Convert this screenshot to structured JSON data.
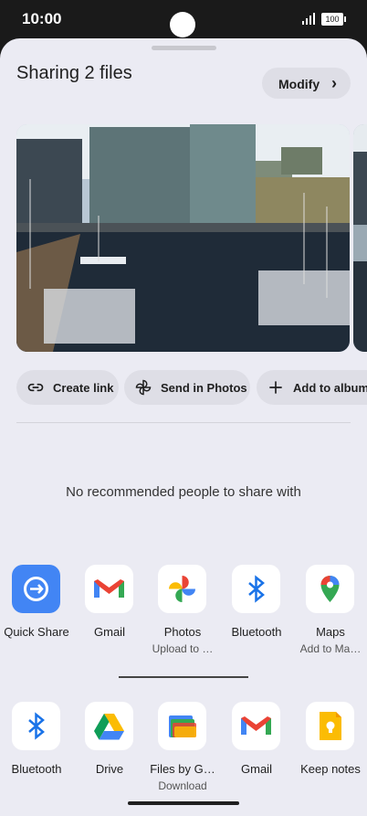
{
  "status_bar": {
    "time": "10:00",
    "battery": "100"
  },
  "sheet": {
    "title": "Sharing 2 files",
    "modify_label": "Modify",
    "actions": [
      {
        "label": "Create link",
        "icon": "link-icon"
      },
      {
        "label": "Send in Photos",
        "icon": "pinwheel-icon"
      },
      {
        "label": "Add to album",
        "icon": "plus-icon"
      }
    ],
    "no_recommended": "No recommended people to share with",
    "apps_row1": [
      {
        "name": "Quick Share",
        "sub": "",
        "icon": "quick-share-icon"
      },
      {
        "name": "Gmail",
        "sub": "",
        "icon": "gmail-icon"
      },
      {
        "name": "Photos",
        "sub": "Upload to …",
        "icon": "photos-icon"
      },
      {
        "name": "Bluetooth",
        "sub": "",
        "icon": "bluetooth-icon"
      },
      {
        "name": "Maps",
        "sub": "Add to Ma…",
        "icon": "maps-icon"
      }
    ],
    "apps_row2": [
      {
        "name": "Bluetooth",
        "sub": "",
        "icon": "bluetooth-icon"
      },
      {
        "name": "Drive",
        "sub": "",
        "icon": "drive-icon"
      },
      {
        "name": "Files by G…",
        "sub": "Download",
        "icon": "files-icon"
      },
      {
        "name": "Gmail",
        "sub": "",
        "icon": "gmail-icon"
      },
      {
        "name": "Keep notes",
        "sub": "",
        "icon": "keep-icon"
      }
    ]
  },
  "colors": {
    "sheet_bg": "#ebebf3",
    "chip_bg": "#dedee6",
    "quick_share_blue": "#4285f4"
  }
}
